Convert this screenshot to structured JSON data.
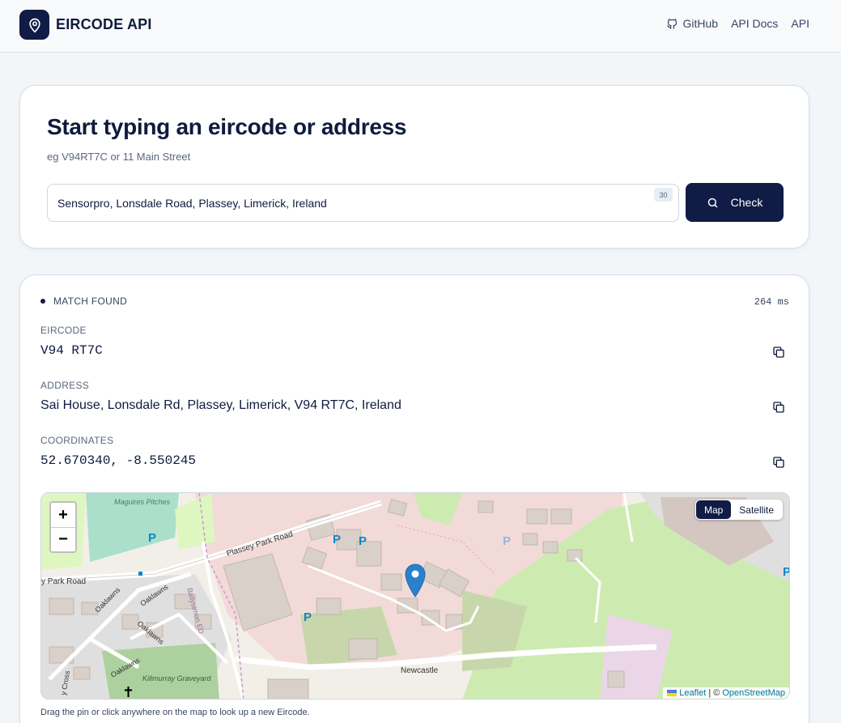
{
  "header": {
    "brand": "EIRCODE API",
    "nav": [
      {
        "label": "GitHub",
        "icon": "github-icon"
      },
      {
        "label": "API Docs"
      },
      {
        "label": "API"
      }
    ]
  },
  "search": {
    "title": "Start typing an eircode or address",
    "hint": "eg V94RT7C or 11 Main Street",
    "value": "Sensorpro, Lonsdale Road, Plassey, Limerick, Ireland",
    "char_count": "30",
    "button_label": "Check"
  },
  "result": {
    "status": "MATCH FOUND",
    "latency": "264 ms",
    "eircode_label": "EIRCODE",
    "eircode": "V94 RT7C",
    "address_label": "ADDRESS",
    "address": "Sai House, Lonsdale Rd, Plassey, Limerick, V94 RT7C, Ireland",
    "coords_label": "COORDINATES",
    "coords": "52.670340, -8.550245"
  },
  "map": {
    "zoom_in": "+",
    "zoom_out": "−",
    "layers": [
      "Map",
      "Satellite"
    ],
    "active_layer": "Map",
    "labels": {
      "pitches": "Maguires Pitches",
      "plassey_park_road": "Plassey Park Road",
      "park_road": "y Park Road",
      "oaklawns_1": "Oaklawns",
      "oaklawns_2": "Oaklawns",
      "oaklawns_3": "Oaklawns",
      "oaklawns_4": "Oaklawns",
      "ballysimon": "Ballysimon ED",
      "graveyard": "Killmurray Graveyard",
      "newcastle": "Newcastle",
      "cross": "y Cross"
    },
    "attribution": {
      "leaflet": "Leaflet",
      "separator": " | © ",
      "osm": "OpenStreetMap"
    },
    "note": "Drag the pin or click anywhere on the map to look up a new Eircode."
  },
  "colors": {
    "primary": "#101c45",
    "background": "#f3f6f9",
    "pin": "#2a81cb"
  }
}
